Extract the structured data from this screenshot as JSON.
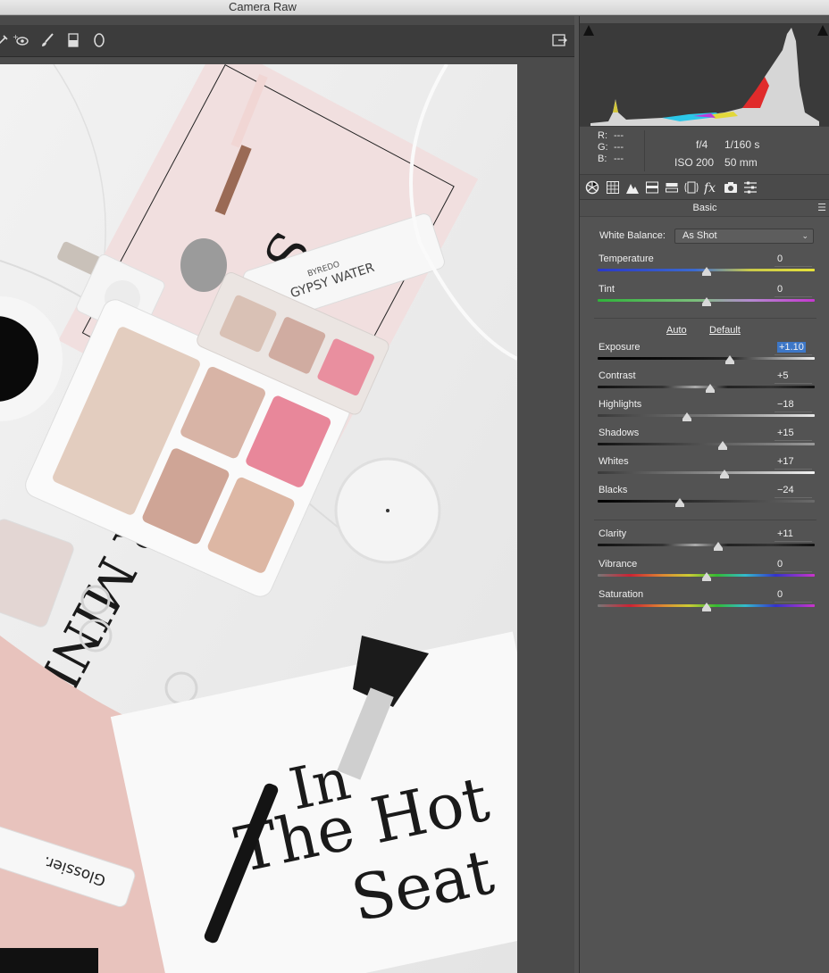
{
  "window": {
    "title": "Camera Raw"
  },
  "toolbar": {
    "tools": [
      "white-balance-tool",
      "red-eye-tool",
      "adjustment-brush-tool",
      "graduated-filter-tool",
      "radial-filter-tool"
    ],
    "toggle_panel": "open-panel-icon"
  },
  "readout": {
    "r_label": "R:",
    "r_value": "---",
    "g_label": "G:",
    "g_value": "---",
    "b_label": "B:",
    "b_value": "---",
    "aperture": "f/4",
    "shutter": "1/160 s",
    "iso": "ISO 200",
    "focal": "50 mm"
  },
  "tabs": [
    "basic-tab-icon",
    "tone-curve-tab-icon",
    "detail-tab-icon",
    "hsl-tab-icon",
    "split-toning-tab-icon",
    "lens-corrections-tab-icon",
    "effects-tab-icon",
    "camera-calibration-tab-icon",
    "presets-tab-icon"
  ],
  "basic": {
    "title": "Basic",
    "white_balance_label": "White Balance:",
    "white_balance_value": "As Shot",
    "auto_label": "Auto",
    "default_label": "Default",
    "sliders": [
      {
        "label": "Temperature",
        "value": "0",
        "position": 0.5
      },
      {
        "label": "Tint",
        "value": "0",
        "position": 0.5
      },
      {
        "label": "Exposure",
        "value": "+1.10",
        "position": 0.61
      },
      {
        "label": "Contrast",
        "value": "+5",
        "position": 0.52
      },
      {
        "label": "Highlights",
        "value": "−18",
        "position": 0.41
      },
      {
        "label": "Shadows",
        "value": "+15",
        "position": 0.575
      },
      {
        "label": "Whites",
        "value": "+17",
        "position": 0.585
      },
      {
        "label": "Blacks",
        "value": "−24",
        "position": 0.38
      },
      {
        "label": "Clarity",
        "value": "+11",
        "position": 0.555
      },
      {
        "label": "Vibrance",
        "value": "0",
        "position": 0.5
      },
      {
        "label": "Saturation",
        "value": "0",
        "position": 0.5
      }
    ]
  },
  "photo": {
    "magazine_top": "STYLE YOUR MIND",
    "tube_brand": "BYREDO",
    "tube_name": "GYPSY WATER",
    "magazine_bottom_1": "In",
    "magazine_bottom_2": "The Hot",
    "magazine_bottom_3": "Seat",
    "glossier_label": "Glossier."
  }
}
